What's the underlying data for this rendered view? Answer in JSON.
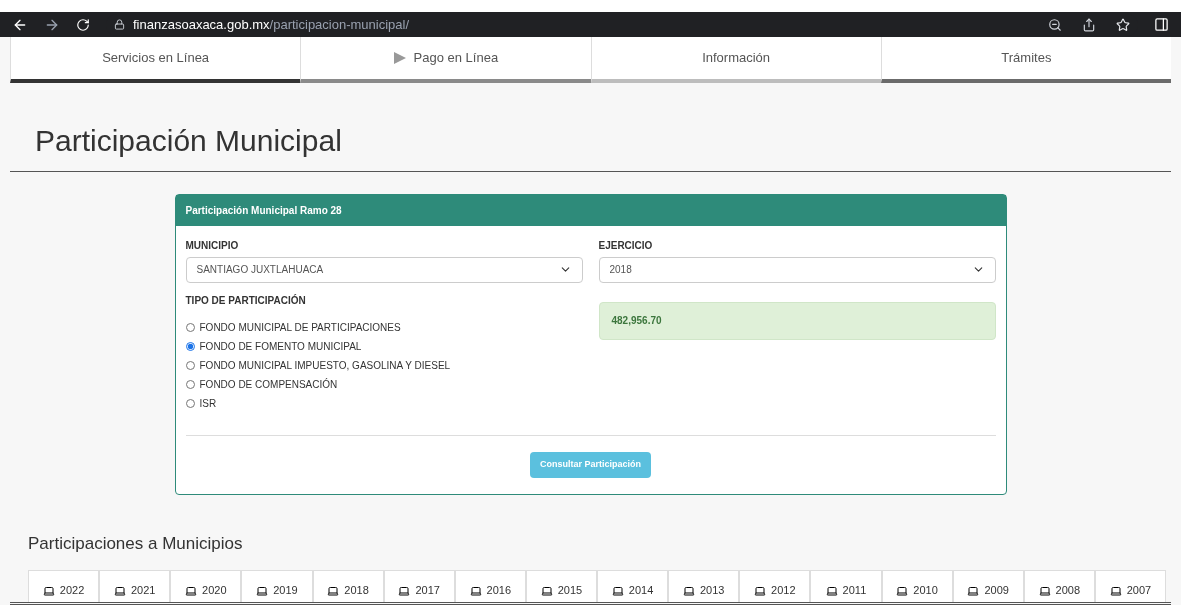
{
  "browser": {
    "domain": "finanzasoaxaca.gob.mx",
    "path": "/participacion-municipal/"
  },
  "nav": [
    {
      "label": "Servicios en Línea",
      "color": "#333333",
      "arrow": false
    },
    {
      "label": "Pago en Línea",
      "color": "#8a8a8a",
      "arrow": true
    },
    {
      "label": "Información",
      "color": "#bdbdbd",
      "arrow": false
    },
    {
      "label": "Trámites",
      "color": "#6b6b6b",
      "arrow": false
    }
  ],
  "title": "Participación Municipal",
  "card": {
    "header": "Participación Municipal Ramo 28",
    "municipio": {
      "label": "MUNICIPIO",
      "value": "SANTIAGO JUXTLAHUACA"
    },
    "ejercicio": {
      "label": "EJERCICIO",
      "value": "2018"
    },
    "tipo_label": "TIPO DE PARTICIPACIÓN",
    "options": [
      {
        "label": "FONDO MUNICIPAL DE PARTICIPACIONES",
        "selected": false
      },
      {
        "label": "FONDO DE FOMENTO MUNICIPAL",
        "selected": true
      },
      {
        "label": "FONDO MUNICIPAL IMPUESTO, GASOLINA Y DIESEL",
        "selected": false
      },
      {
        "label": "FONDO DE COMPENSACIÓN",
        "selected": false
      },
      {
        "label": "ISR",
        "selected": false
      }
    ],
    "result": "482,956.70",
    "button": "Consultar Participación"
  },
  "section_title": "Participaciones a Municipios",
  "years": [
    "2022",
    "2021",
    "2020",
    "2019",
    "2018",
    "2017",
    "2016",
    "2015",
    "2014",
    "2013",
    "2012",
    "2011",
    "2010",
    "2009",
    "2008",
    "2007"
  ]
}
